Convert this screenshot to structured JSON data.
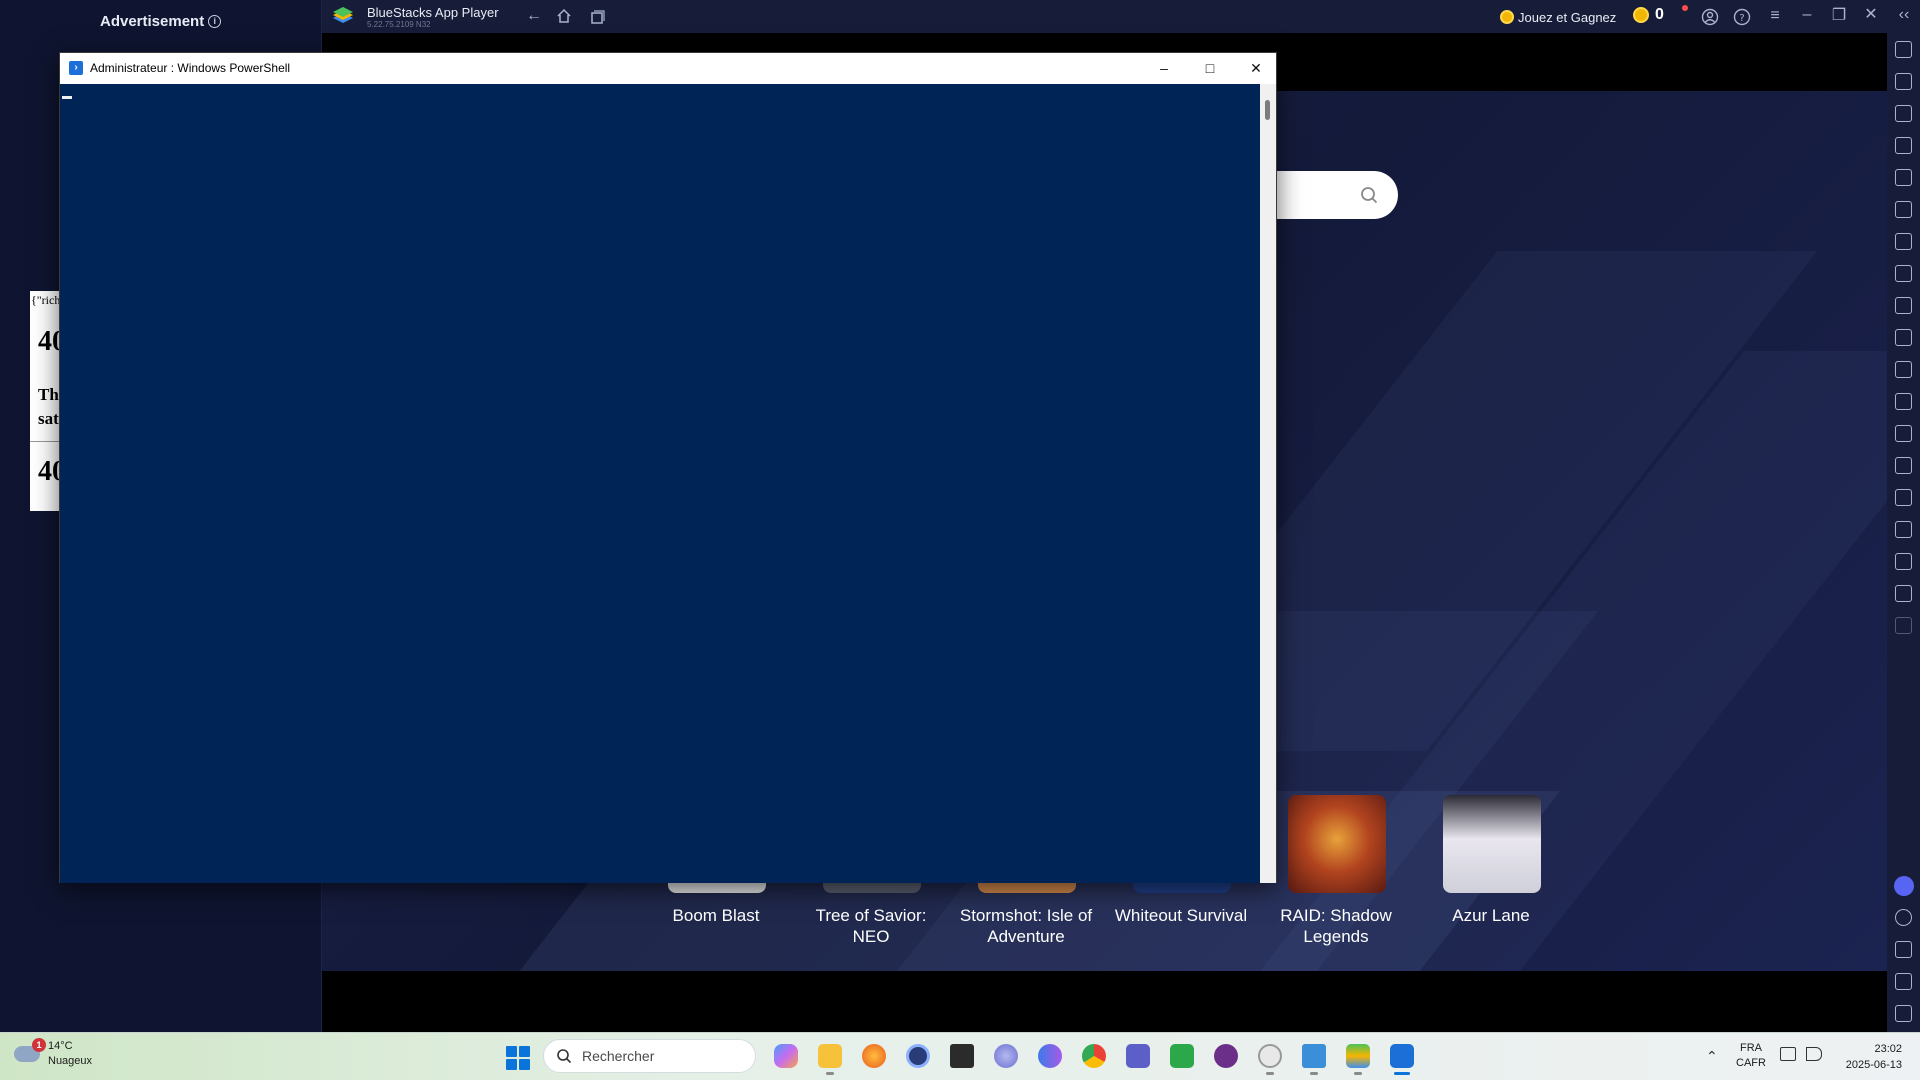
{
  "ad_panel": {
    "title": "Advertisement",
    "info_icon": "i",
    "raw_text": "{\"rich",
    "heading_top": "40",
    "paragraph_line1": "Th",
    "paragraph_line2": "sat",
    "heading_bottom": "40"
  },
  "bluestacks": {
    "app_name": "BlueStacks App Player",
    "version": "5.22.75.2109  N32",
    "play_earn_label": "Jouez et Gagnez",
    "coin_count": "0",
    "games": [
      {
        "title_line1": "Boom Blast",
        "title_line2": ""
      },
      {
        "title_line1": "Tree of Savior: NEO",
        "title_line2": ""
      },
      {
        "title_line1": "Stormshot: Isle of",
        "title_line2": "Adventure"
      },
      {
        "title_line1": "Whiteout Survival",
        "title_line2": ""
      },
      {
        "title_line1": "RAID: Shadow",
        "title_line2": "Legends"
      },
      {
        "title_line1": "Azur Lane",
        "title_line2": ""
      }
    ],
    "colors": {
      "background": "#1a2149",
      "titlebar": "#171d38",
      "accent_coin": "#f2b705"
    }
  },
  "powershell": {
    "window_title": "Administrateur : Windows PowerShell",
    "background_color": "#012456"
  },
  "taskbar": {
    "weather_temp": "14°C",
    "weather_desc": "Nuageux",
    "weather_badge": "1",
    "search_placeholder": "Rechercher",
    "lang_top": "FRA",
    "lang_bottom": "CAFR",
    "time": "23:02",
    "date": "2025-06-13"
  }
}
